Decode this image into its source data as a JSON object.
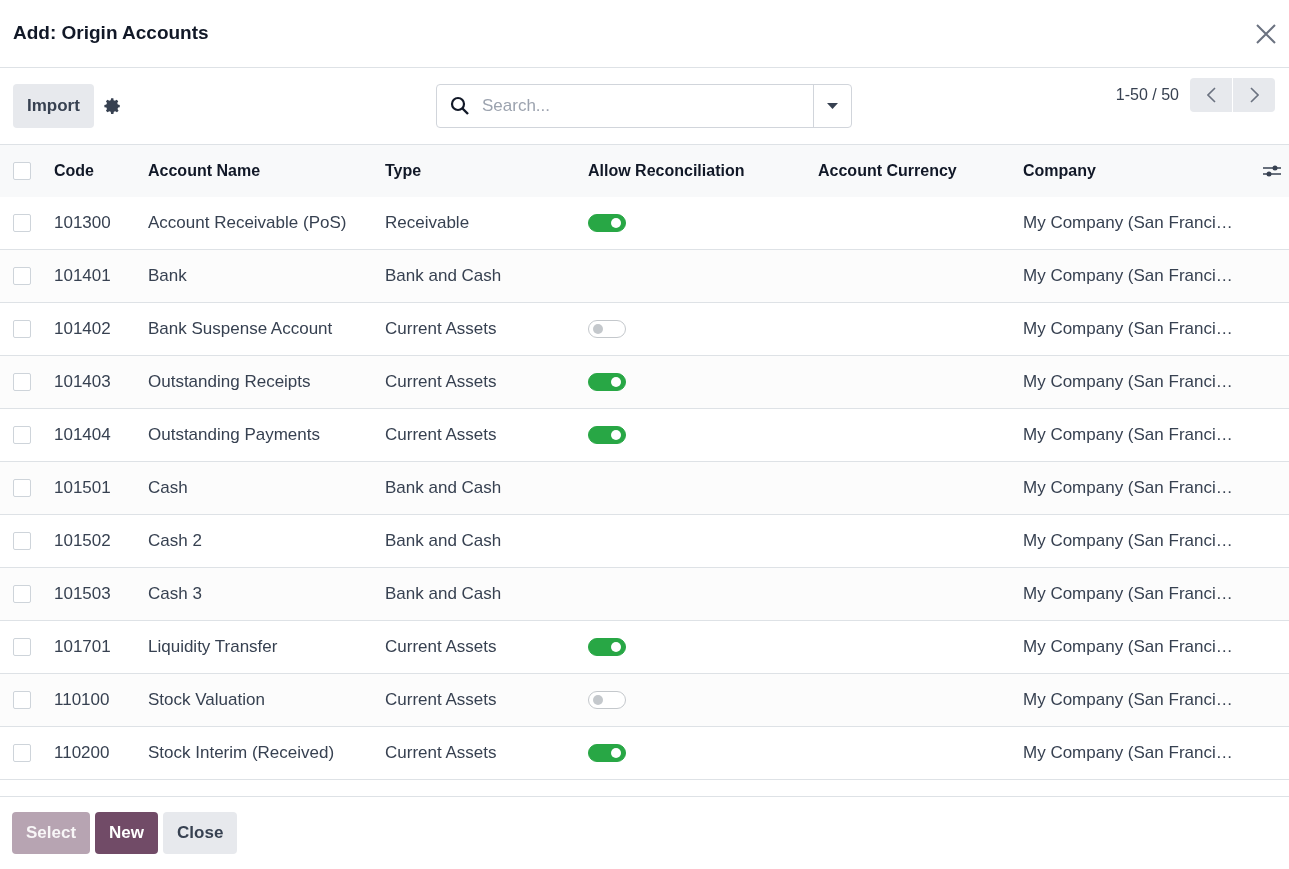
{
  "dialog": {
    "title": "Add: Origin Accounts"
  },
  "toolbar": {
    "import_label": "Import",
    "search": {
      "placeholder": "Search..."
    },
    "pager": "1-50 / 50"
  },
  "table": {
    "select_all_checked": false,
    "columns": [
      "Code",
      "Account Name",
      "Type",
      "Allow Reconciliation",
      "Account Currency",
      "Company"
    ],
    "rows": [
      {
        "checked": false,
        "code": "101300",
        "name": "Account Receivable (PoS)",
        "type": "Receivable",
        "reconcile": true,
        "company": "My Company (San Franci…"
      },
      {
        "checked": false,
        "code": "101401",
        "name": "Bank",
        "type": "Bank and Cash",
        "company": "My Company (San Franci…"
      },
      {
        "checked": false,
        "code": "101402",
        "name": "Bank Suspense Account",
        "type": "Current Assets",
        "reconcile": false,
        "company": "My Company (San Franci…"
      },
      {
        "checked": false,
        "code": "101403",
        "name": "Outstanding Receipts",
        "type": "Current Assets",
        "reconcile": true,
        "company": "My Company (San Franci…"
      },
      {
        "checked": false,
        "code": "101404",
        "name": "Outstanding Payments",
        "type": "Current Assets",
        "reconcile": true,
        "company": "My Company (San Franci…"
      },
      {
        "checked": false,
        "code": "101501",
        "name": "Cash",
        "type": "Bank and Cash",
        "company": "My Company (San Franci…"
      },
      {
        "checked": false,
        "code": "101502",
        "name": "Cash 2",
        "type": "Bank and Cash",
        "company": "My Company (San Franci…"
      },
      {
        "checked": false,
        "code": "101503",
        "name": "Cash 3",
        "type": "Bank and Cash",
        "company": "My Company (San Franci…"
      },
      {
        "checked": false,
        "code": "101701",
        "name": "Liquidity Transfer",
        "type": "Current Assets",
        "reconcile": true,
        "company": "My Company (San Franci…"
      },
      {
        "checked": false,
        "code": "110100",
        "name": "Stock Valuation",
        "type": "Current Assets",
        "reconcile": false,
        "company": "My Company (San Franci…"
      },
      {
        "checked": false,
        "code": "110200",
        "name": "Stock Interim (Received)",
        "type": "Current Assets",
        "reconcile": true,
        "company": "My Company (San Franci…"
      }
    ]
  },
  "footer": {
    "buttons": [
      {
        "label": "Select",
        "kind": "primary",
        "disabled": true
      },
      {
        "label": "New",
        "kind": "primary",
        "disabled": false
      },
      {
        "label": "Close",
        "kind": "secondary",
        "disabled": false
      }
    ]
  }
}
